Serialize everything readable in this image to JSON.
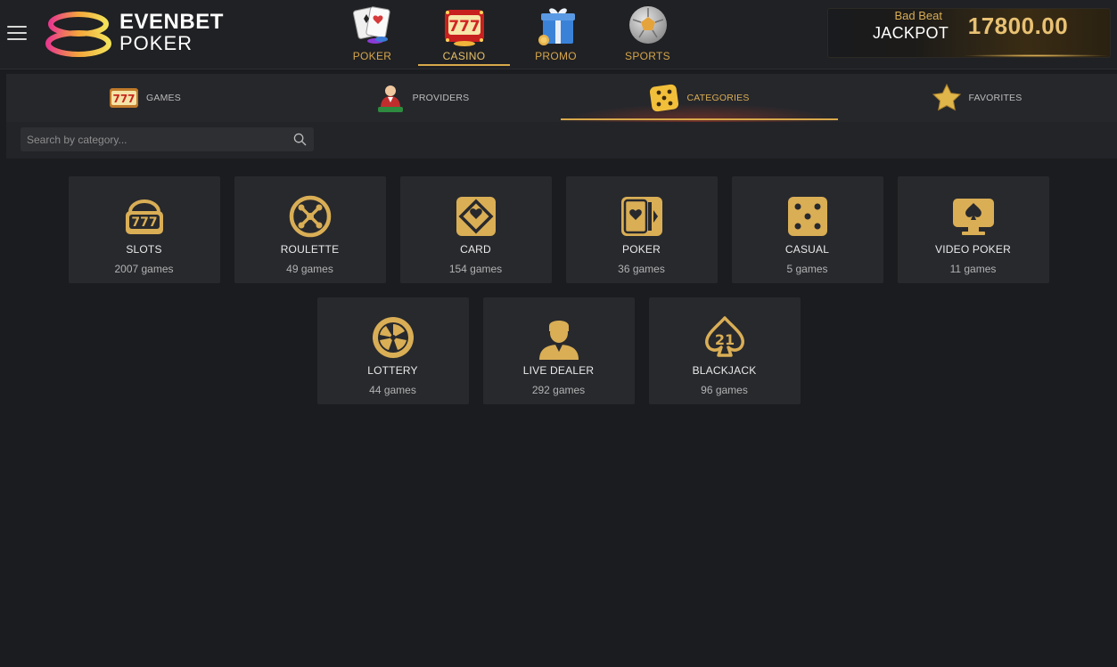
{
  "header": {
    "logo": {
      "line1": "EVENBET",
      "line2": "POKER"
    },
    "nav": [
      {
        "label": "POKER",
        "icon": "playing-cards-icon",
        "active": false
      },
      {
        "label": "CASINO",
        "icon": "slot-777-icon",
        "active": true
      },
      {
        "label": "PROMO",
        "icon": "gift-box-icon",
        "active": false
      },
      {
        "label": "SPORTS",
        "icon": "soccer-ball-icon",
        "active": false
      }
    ],
    "jackpot": {
      "subtitle": "Bad Beat",
      "title": "JACKPOT",
      "amount": "17800.00"
    }
  },
  "tabs": [
    {
      "label": "GAMES",
      "icon": "slot-777-icon",
      "active": false
    },
    {
      "label": "PROVIDERS",
      "icon": "dealer-icon",
      "active": false
    },
    {
      "label": "CATEGORIES",
      "icon": "dice-icon",
      "active": true
    },
    {
      "label": "FAVORITES",
      "icon": "star-icon",
      "active": false
    }
  ],
  "search": {
    "placeholder": "Search by category...",
    "value": ""
  },
  "categories": [
    {
      "name": "SLOTS",
      "count": "2007 games",
      "icon": "slot-machine-icon"
    },
    {
      "name": "ROULETTE",
      "count": "49 games",
      "icon": "roulette-icon"
    },
    {
      "name": "CARD",
      "count": "154 games",
      "icon": "card-diamond-icon"
    },
    {
      "name": "POKER",
      "count": "36 games",
      "icon": "poker-cards-icon"
    },
    {
      "name": "CASUAL",
      "count": "5 games",
      "icon": "dice-five-icon"
    },
    {
      "name": "VIDEO POKER",
      "count": "11 games",
      "icon": "monitor-spade-icon"
    },
    {
      "name": "LOTTERY",
      "count": "44 games",
      "icon": "lottery-wheel-icon"
    },
    {
      "name": "LIVE DEALER",
      "count": "292 games",
      "icon": "person-icon"
    },
    {
      "name": "BLACKJACK",
      "count": "96 games",
      "icon": "spade-21-icon"
    }
  ],
  "colors": {
    "accent": "#d8a94b",
    "background": "#1b1c1f",
    "card": "#28292d"
  }
}
